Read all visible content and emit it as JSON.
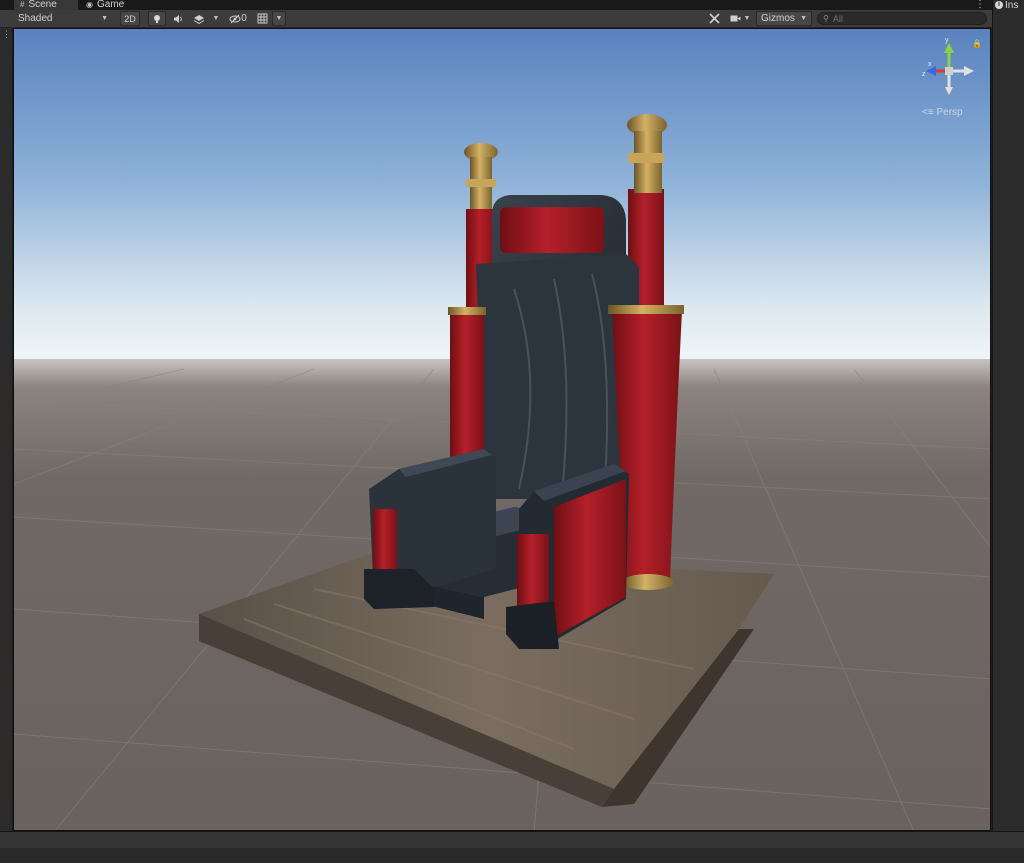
{
  "tabs": [
    {
      "label": "Scene",
      "icon": "grid-icon"
    },
    {
      "label": "Game",
      "icon": "gamepad-icon"
    }
  ],
  "inspector_tab": {
    "label": "Ins",
    "icon": "info-icon"
  },
  "toolbar": {
    "shading_mode": "Shaded",
    "toggle_2d": "2D",
    "visibility_count": "0",
    "gizmos_label": "Gizmos",
    "search_placeholder": "All"
  },
  "scene_gizmo": {
    "axis_x": "x",
    "axis_y": "y",
    "axis_z": "z",
    "projection": "Persp",
    "colors": {
      "x": "#db3b2c",
      "y": "#8ed33d",
      "z": "#3a66e0"
    }
  },
  "scene": {
    "object": "throne",
    "colors": {
      "sky_top": "#5a82be",
      "horizon": "#f1f7f8",
      "ground": "#6e6762",
      "wood_base": "#6b5e52",
      "dark_wood": "#2b323b",
      "red_fabric": "#9c1820",
      "gold": "#a88a45"
    }
  }
}
